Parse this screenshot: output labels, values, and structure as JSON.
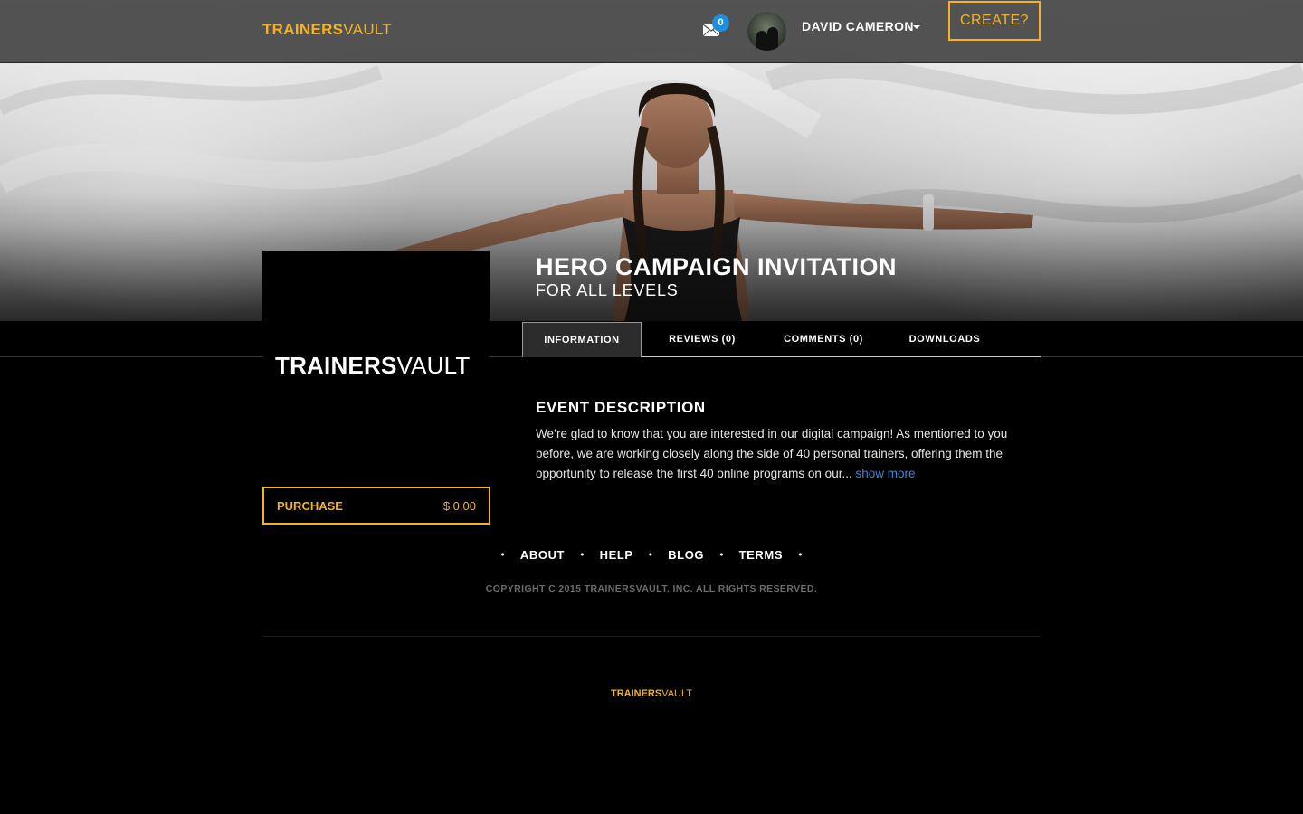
{
  "brand": {
    "logo_bold": "TRAINERS",
    "logo_thin": "VAULT",
    "accent_color": "#f5b323",
    "link_color": "#3b86d6",
    "badge_color": "#1e8fe0"
  },
  "header": {
    "messages_count": "0",
    "user_name": "DAVID CAMERON",
    "create_label": "CREATE?"
  },
  "event": {
    "title": "HERO CAMPAIGN INVITATION",
    "subtitle": "FOR ALL LEVELS"
  },
  "tabs": [
    {
      "label": "INFORMATION",
      "active": true
    },
    {
      "label": "REVIEWS (0)",
      "active": false
    },
    {
      "label": "COMMENTS (0)",
      "active": false
    },
    {
      "label": "DOWNLOADS",
      "active": false
    }
  ],
  "card": {
    "logo_bold": "TRAINERS",
    "logo_thin": "VAULT"
  },
  "purchase": {
    "label": "PURCHASE",
    "price": "$ 0.00"
  },
  "description": {
    "heading": "EVENT DESCRIPTION",
    "text": "We’re glad to know that you are interested in our digital campaign!   As mentioned to you before, we are working closely along the side of 40 personal trainers, offering them the opportunity to release the first 40 online programs on our...",
    "show_more": "show more"
  },
  "footer": {
    "links": [
      "ABOUT",
      "HELP",
      "BLOG",
      "TERMS"
    ],
    "copyright": "COPYRIGHT C 2015 TRAINERSVAULT, INC. ALL RIGHTS RESERVED.",
    "logo_bold": "TRAINERS",
    "logo_thin": "VAULT"
  }
}
